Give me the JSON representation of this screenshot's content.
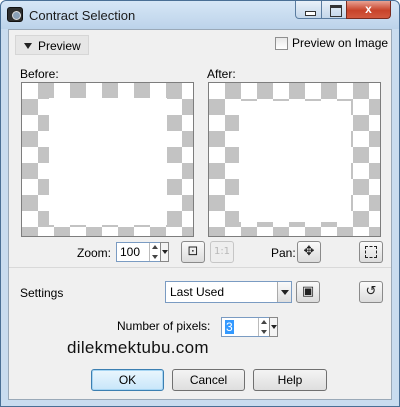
{
  "window": {
    "title": "Contract Selection",
    "close_glyph": "x"
  },
  "preview": {
    "toggle_label": "Preview",
    "preview_on_image_label": "Preview on Image",
    "preview_on_image_checked": false,
    "before_label": "Before:",
    "after_label": "After:"
  },
  "zoom": {
    "label": "Zoom:",
    "value": "100"
  },
  "pan": {
    "label": "Pan:"
  },
  "icons": {
    "zoom_fit": "zoom-to-fit-icon",
    "actual_size": "actual-size-icon",
    "pan": "move-arrows-icon",
    "selection": "dashed-selection-icon",
    "save_preset": "floppy-disk-icon",
    "reset": "reset-icon"
  },
  "settings": {
    "label": "Settings",
    "preset_value": "Last Used"
  },
  "pixels": {
    "label": "Number of pixels:",
    "value": "3"
  },
  "watermark": "dilekmektubu.com",
  "buttons": {
    "ok": "OK",
    "cancel": "Cancel",
    "help": "Help"
  },
  "colors": {
    "title_bar": "#c9dcef",
    "close_button": "#c8432a",
    "dialog_background": "#f0f0f0",
    "checker": "#c3c3c3"
  }
}
